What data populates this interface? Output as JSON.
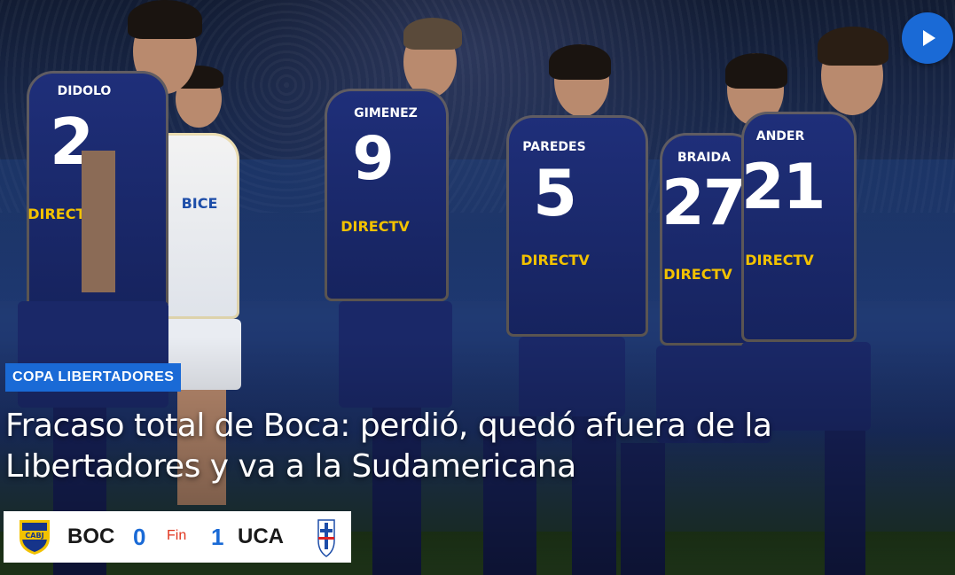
{
  "media": {
    "play_icon": "play-icon"
  },
  "article": {
    "category": "COPA LIBERTADORES",
    "headline": "Fracaso total de Boca: perdió, quedó afuera de la Libertadores y va a la Sudamericana"
  },
  "photo": {
    "players": [
      {
        "name": "DIDOLO",
        "number": "2"
      },
      {
        "name": "GIMENEZ",
        "number": "9"
      },
      {
        "name": "PAREDES",
        "number": "5"
      },
      {
        "name": "BRAIDA",
        "number": "27"
      },
      {
        "name": "ANDER",
        "number": "21"
      }
    ],
    "sponsor": "DIRECTV",
    "rival_sponsor": "BICE"
  },
  "scoreboard": {
    "home_team": "BOC",
    "home_score": "0",
    "status": "Fin",
    "away_score": "1",
    "away_team": "UCA",
    "home_crest_text": "CABJ",
    "colors": {
      "accent": "#1a6ad6",
      "status": "#e0341d"
    }
  }
}
